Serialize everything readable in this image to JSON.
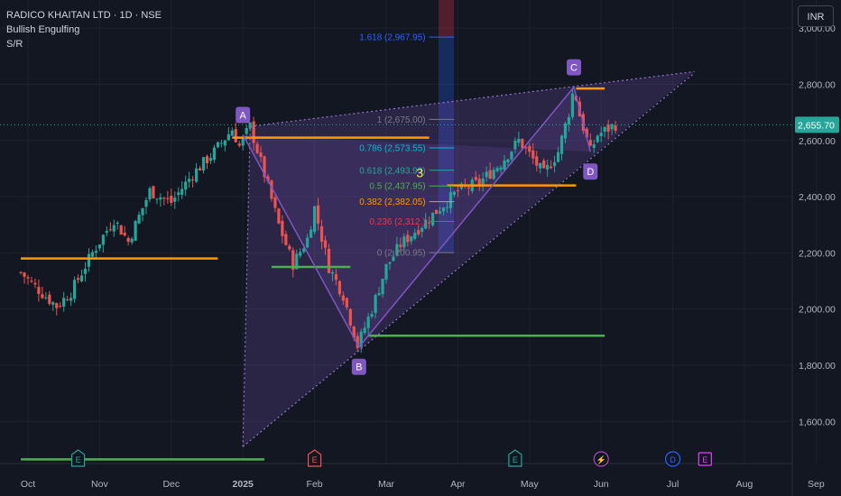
{
  "legend": {
    "title": "RADICO KHAITAN LTD · 1D · NSE",
    "indicator1": "Bullish Engulfing",
    "indicator2": "S/R"
  },
  "currency": "INR",
  "colors": {
    "background": "#131722",
    "up": "#26a69a",
    "down": "#ef5350",
    "support": "#4caf50",
    "resistance": "#ff9800",
    "pattern": "#7e57c2",
    "fib_blue": "#2962ff",
    "fib_teal": "#22ab94"
  },
  "chart_data": {
    "type": "candlestick",
    "title": "RADICO KHAITAN LTD · 1D · NSE",
    "ylim": [
      1450,
      3100
    ],
    "last_price": "2,655.70",
    "y_ticks": [
      "1,600.00",
      "1,800.00",
      "2,000.00",
      "2,200.00",
      "2,400.00",
      "2,600.00",
      "2,800.00",
      "3,000.00"
    ],
    "x_ticks": [
      "Oct",
      "Nov",
      "Dec",
      "2025",
      "Feb",
      "Mar",
      "Apr",
      "May",
      "Jun",
      "Jul",
      "Aug",
      "Sep"
    ],
    "price_path": [
      [
        -0.1,
        2130
      ],
      [
        0.1,
        2080
      ],
      [
        0.4,
        2010
      ],
      [
        0.6,
        2060
      ],
      [
        0.9,
        2200
      ],
      [
        1.2,
        2320
      ],
      [
        1.4,
        2240
      ],
      [
        1.7,
        2420
      ],
      [
        2.0,
        2380
      ],
      [
        2.3,
        2480
      ],
      [
        2.6,
        2560
      ],
      [
        2.85,
        2640
      ],
      [
        2.95,
        2580
      ],
      [
        3.1,
        2650
      ],
      [
        3.3,
        2480
      ],
      [
        3.5,
        2300
      ],
      [
        3.7,
        2160
      ],
      [
        3.9,
        2250
      ],
      [
        4.0,
        2360
      ],
      [
        4.2,
        2150
      ],
      [
        4.4,
        2050
      ],
      [
        4.6,
        1870
      ],
      [
        4.8,
        2000
      ],
      [
        5.0,
        2150
      ],
      [
        5.2,
        2230
      ],
      [
        5.5,
        2300
      ],
      [
        5.75,
        2360
      ],
      [
        6.0,
        2420
      ],
      [
        6.3,
        2450
      ],
      [
        6.6,
        2520
      ],
      [
        6.85,
        2600
      ],
      [
        7.0,
        2550
      ],
      [
        7.2,
        2480
      ],
      [
        7.4,
        2560
      ],
      [
        7.55,
        2700
      ],
      [
        7.62,
        2790
      ],
      [
        7.7,
        2690
      ],
      [
        7.85,
        2560
      ],
      [
        7.95,
        2620
      ],
      [
        8.2,
        2656
      ]
    ],
    "pattern_points": [
      {
        "label": "A",
        "x": 3.0,
        "y": 2620
      },
      {
        "label": "B",
        "x": 4.62,
        "y": 1865
      },
      {
        "label": "C",
        "x": 7.62,
        "y": 2790
      },
      {
        "label": "D",
        "x": 7.85,
        "y": 2560
      }
    ],
    "wedge": {
      "upper": [
        [
          3.1,
          2650
        ],
        [
          9.3,
          2845
        ]
      ],
      "lower": [
        [
          3.0,
          1510
        ],
        [
          9.3,
          2840
        ]
      ]
    },
    "fibonacci": [
      {
        "ratio": "1.618",
        "price": "2,967.95",
        "value": 2967.95,
        "color": "#2962ff"
      },
      {
        "ratio": "1",
        "price": "2,675.00",
        "value": 2675.0,
        "color": "#787b86"
      },
      {
        "ratio": "0.786",
        "price": "2,573.55",
        "value": 2573.55,
        "color": "#00bcd4"
      },
      {
        "ratio": "0.618",
        "price": "2,493.93",
        "value": 2493.93,
        "color": "#22ab94"
      },
      {
        "ratio": "0.5",
        "price": "2,437.95",
        "value": 2437.95,
        "color": "#4caf50"
      },
      {
        "ratio": "0.382",
        "price": "2,382.05",
        "value": 2382.05,
        "color": "#ff9800"
      },
      {
        "ratio": "0.236",
        "price": "2,312.",
        "value": 2312.0,
        "color": "#f23645"
      },
      {
        "ratio": "0",
        "price": "2,200.95",
        "value": 2200.95,
        "color": "#787b86"
      }
    ],
    "fib_marker": "3",
    "resistance_levels": [
      {
        "value": 2180,
        "from": -0.1,
        "to": 2.65
      },
      {
        "value": 2610,
        "from": 2.85,
        "to": 5.6
      },
      {
        "value": 2440,
        "from": 5.85,
        "to": 7.65
      },
      {
        "value": 2785,
        "from": 7.65,
        "to": 8.05
      }
    ],
    "support_levels": [
      {
        "value": 2150,
        "from": 3.4,
        "to": 4.5
      },
      {
        "value": 1905,
        "from": 4.75,
        "to": 8.05
      },
      {
        "value": 1465,
        "from": -0.1,
        "to": 3.3
      }
    ],
    "events": [
      {
        "label": "E",
        "x": 0.7,
        "color": "#26a69a",
        "shape": "earnings"
      },
      {
        "label": "E",
        "x": 4.0,
        "color": "#ef5350",
        "shape": "earnings"
      },
      {
        "label": "E",
        "x": 6.8,
        "color": "#26a69a",
        "shape": "earnings"
      },
      {
        "label": "⚡",
        "x": 8.0,
        "color": "#ab47bc",
        "shape": "circle"
      },
      {
        "label": "D",
        "x": 9.0,
        "color": "#2962ff",
        "shape": "circle"
      },
      {
        "label": "E",
        "x": 9.45,
        "color": "#e040fb",
        "shape": "square"
      }
    ]
  }
}
